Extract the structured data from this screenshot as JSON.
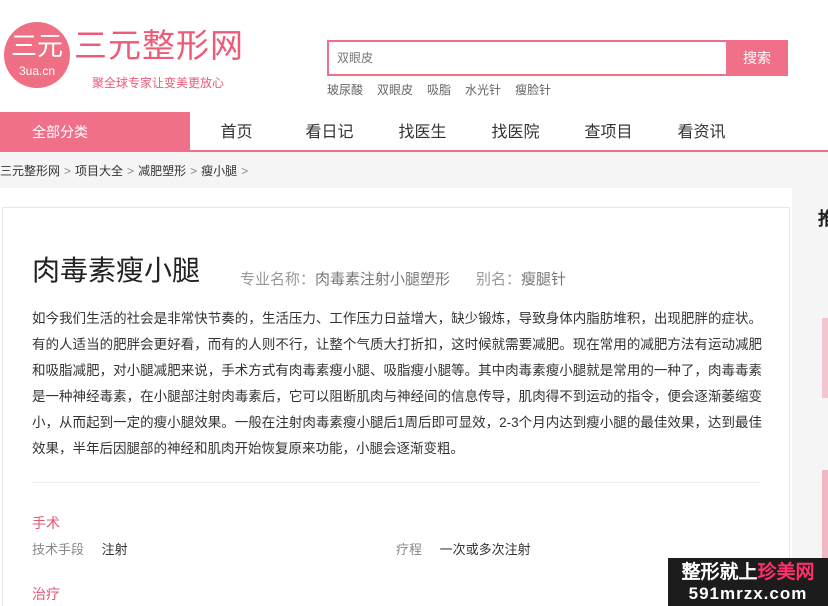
{
  "header": {
    "logo_big": "三元",
    "logo_small": "3ua.cn",
    "site_name": "三元整形网",
    "slogan": "聚全球专家让变美更放心"
  },
  "search": {
    "placeholder": "双眼皮",
    "button_label": "搜索",
    "hot_tags": [
      "玻尿酸",
      "双眼皮",
      "吸脂",
      "水光针",
      "瘦脸针"
    ]
  },
  "nav": {
    "all_categories": "全部分类",
    "items": [
      "首页",
      "看日记",
      "找医生",
      "找医院",
      "查项目",
      "看资讯"
    ]
  },
  "breadcrumb": {
    "items": [
      "三元整形网",
      "项目大全",
      "减肥塑形",
      "瘦小腿"
    ],
    "separator": ">"
  },
  "project": {
    "title": "肉毒素瘦小腿",
    "pro_name_label": "专业名称：",
    "pro_name": "肉毒素注射小腿塑形",
    "alias_label": "别名：",
    "alias": "瘦腿针",
    "description": "如今我们生活的社会是非常快节奏的，生活压力、工作压力日益增大，缺少锻炼，导致身体内脂肪堆积，出现肥胖的症状。有的人适当的肥胖会更好看，而有的人则不行，让整个气质大打折扣，这时候就需要减肥。现在常用的减肥方法有运动减肥和吸脂减肥，对小腿减肥来说，手术方式有肉毒素瘦小腿、吸脂瘦小腿等。其中肉毒素瘦小腿就是常用的一种了，肉毒毒素是一种神经毒素，在小腿部注射肉毒素后，它可以阻断肌肉与神经间的信息传导，肌肉得不到运动的指令，便会逐渐萎缩变小，从而起到一定的瘦小腿效果。一般在注射肉毒素瘦小腿后1周后即可显效，2-3个月内达到瘦小腿的最佳效果，达到最佳效果，半年后因腿部的神经和肌肉开始恢复原来功能，小腿会逐渐变粗。"
  },
  "surgery": {
    "section_title": "手术",
    "technique_label": "技术手段",
    "technique_value": "注射",
    "course_label": "疗程",
    "course_value": "一次或多次注射"
  },
  "treatment": {
    "section_title": "治疗"
  },
  "sidebar": {
    "partial_char": "推"
  },
  "watermark": {
    "line1_prefix": "整形就上",
    "line1_highlight": "珍美网",
    "line2": "591mrzx.com"
  },
  "colors": {
    "brand_pink": "#ef7088",
    "section_pink": "#e05a74"
  }
}
